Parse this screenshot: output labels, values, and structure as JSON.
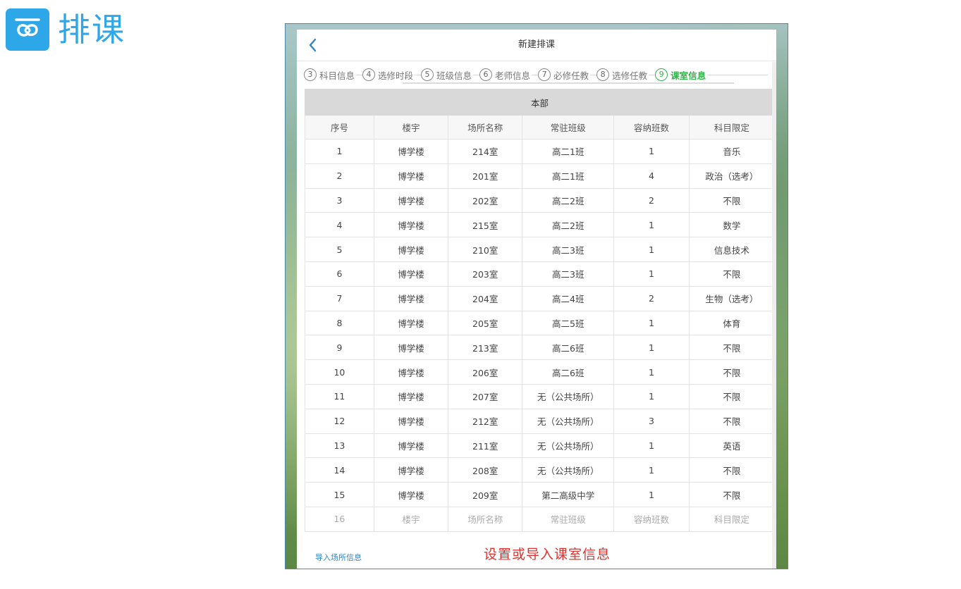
{
  "app": {
    "title": "排课",
    "logo_icon": "cloud-icon",
    "accent": "#2da7e8"
  },
  "window": {
    "title": "新建排课",
    "back_icon": "chevron-left-icon"
  },
  "steps": [
    {
      "num": "3",
      "label": "科目信息",
      "active": false
    },
    {
      "num": "4",
      "label": "选修时段",
      "active": false
    },
    {
      "num": "5",
      "label": "班级信息",
      "active": false
    },
    {
      "num": "6",
      "label": "老师信息",
      "active": false
    },
    {
      "num": "7",
      "label": "必修任教",
      "active": false
    },
    {
      "num": "8",
      "label": "选修任教",
      "active": false
    },
    {
      "num": "9",
      "label": "课室信息",
      "active": true
    }
  ],
  "table": {
    "campus": "本部",
    "columns": [
      "序号",
      "楼宇",
      "场所名称",
      "常驻班级",
      "容纳班数",
      "科目限定"
    ],
    "rows": [
      [
        "1",
        "博学楼",
        "214室",
        "高二1班",
        "1",
        "音乐"
      ],
      [
        "2",
        "博学楼",
        "201室",
        "高二1班",
        "4",
        "政治（选考）"
      ],
      [
        "3",
        "博学楼",
        "202室",
        "高二2班",
        "2",
        "不限"
      ],
      [
        "4",
        "博学楼",
        "215室",
        "高二2班",
        "1",
        "数学"
      ],
      [
        "5",
        "博学楼",
        "210室",
        "高二3班",
        "1",
        "信息技术"
      ],
      [
        "6",
        "博学楼",
        "203室",
        "高二3班",
        "1",
        "不限"
      ],
      [
        "7",
        "博学楼",
        "204室",
        "高二4班",
        "2",
        "生物（选考）"
      ],
      [
        "8",
        "博学楼",
        "205室",
        "高二5班",
        "1",
        "体育"
      ],
      [
        "9",
        "博学楼",
        "213室",
        "高二6班",
        "1",
        "不限"
      ],
      [
        "10",
        "博学楼",
        "206室",
        "高二6班",
        "1",
        "不限"
      ],
      [
        "11",
        "博学楼",
        "207室",
        "无（公共场所）",
        "1",
        "不限"
      ],
      [
        "12",
        "博学楼",
        "212室",
        "无（公共场所）",
        "3",
        "不限"
      ],
      [
        "13",
        "博学楼",
        "211室",
        "无（公共场所）",
        "1",
        "英语"
      ],
      [
        "14",
        "博学楼",
        "208室",
        "无（公共场所）",
        "1",
        "不限"
      ],
      [
        "15",
        "博学楼",
        "209室",
        "第二高级中学",
        "1",
        "不限"
      ]
    ],
    "new_row": {
      "num": "16",
      "placeholders": [
        "楼宇",
        "场所名称",
        "常驻班级",
        "容纳班数",
        "科目限定"
      ]
    }
  },
  "footer": {
    "import_link": "导入场所信息",
    "hint": "设置或导入课室信息"
  },
  "colors": {
    "active_step": "#34b34a",
    "hint": "#e0322e",
    "link": "#2d86c9"
  }
}
